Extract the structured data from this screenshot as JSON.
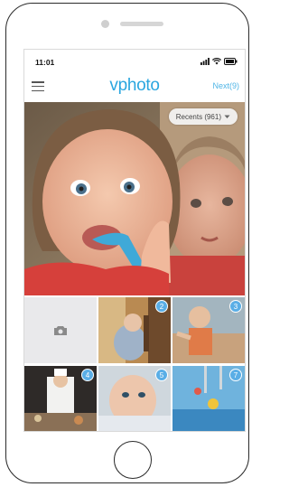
{
  "status_bar": {
    "time": "11:01"
  },
  "nav": {
    "logo": "vphoto",
    "next_label": "Next(9)"
  },
  "album": {
    "label": "Recents (961)"
  },
  "grid": {
    "badges": [
      "2",
      "3",
      "4",
      "5",
      "7"
    ]
  },
  "colors": {
    "accent": "#2aa6df",
    "badge": "#5aaee6"
  }
}
